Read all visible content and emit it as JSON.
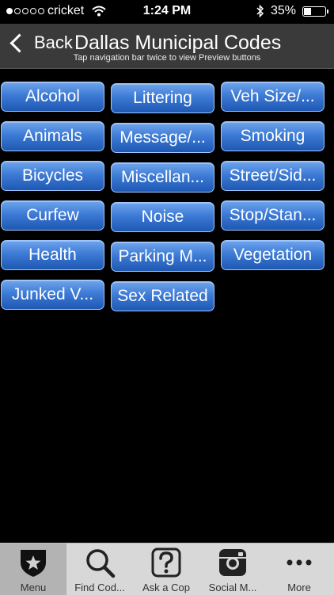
{
  "status": {
    "carrier": "cricket",
    "time": "1:24 PM",
    "battery_text": "35%",
    "battery_level": 0.35,
    "signal_bars": 1
  },
  "nav": {
    "back_label": "Back",
    "title": "Dallas Municipal Codes",
    "subtitle": "Tap navigation bar twice to view Preview buttons"
  },
  "categories": [
    "Alcohol",
    "Littering",
    "Veh Size/...",
    "Animals",
    "Message/...",
    "Smoking",
    "Bicycles",
    "Miscellan...",
    "Street/Sid...",
    "Curfew",
    "Noise",
    "Stop/Stan...",
    "Health",
    "Parking M...",
    "Vegetation",
    "Junked V...",
    "Sex Related"
  ],
  "tabs": [
    {
      "label": "Menu",
      "icon": "shield-star-icon",
      "active": true
    },
    {
      "label": "Find Cod...",
      "icon": "magnifier-icon",
      "active": false
    },
    {
      "label": "Ask a Cop",
      "icon": "question-icon",
      "active": false
    },
    {
      "label": "Social M...",
      "icon": "instagram-icon",
      "active": false
    },
    {
      "label": "More",
      "icon": "more-dots-icon",
      "active": false
    }
  ],
  "colors": {
    "button_top": "#6fa4ec",
    "button_bottom": "#1e58b2",
    "nav_bg": "#3a3a3a",
    "tab_bg": "#d8d8d8"
  }
}
